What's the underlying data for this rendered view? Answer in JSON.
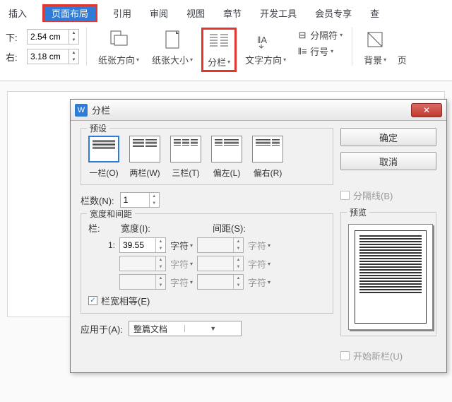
{
  "ribbon": {
    "tabs": [
      "插入",
      "页面布局",
      "引用",
      "审阅",
      "视图",
      "章节",
      "开发工具",
      "会员专享",
      "查"
    ],
    "active": 1,
    "margins": {
      "top_lbl": "下:",
      "top_val": "2.54 cm",
      "right_lbl": "右:",
      "right_val": "3.18 cm"
    },
    "orientation": "纸张方向",
    "size": "纸张大小",
    "columns": "分栏",
    "textdir": "文字方向",
    "breaks": "分隔符",
    "lineno": "行号",
    "background": "背景",
    "page": "页"
  },
  "dialog": {
    "title": "分栏",
    "ok": "确定",
    "cancel": "取消",
    "preset_legend": "预设",
    "presets": [
      "一栏(O)",
      "两栏(W)",
      "三栏(T)",
      "偏左(L)",
      "偏右(R)"
    ],
    "count_lbl": "栏数(N):",
    "count_val": "1",
    "sepline": "分隔线(B)",
    "wd_legend": "宽度和间距",
    "col_hdr": "栏:",
    "width_hdr": "宽度(I):",
    "spacing_hdr": "间距(S):",
    "row1_idx": "1:",
    "row1_width": "39.55",
    "unit": "字符",
    "equal": "栏宽相等(E)",
    "preview_legend": "预览",
    "apply_lbl": "应用于(A):",
    "apply_val": "整篇文档",
    "newcol": "开始新栏(U)"
  }
}
